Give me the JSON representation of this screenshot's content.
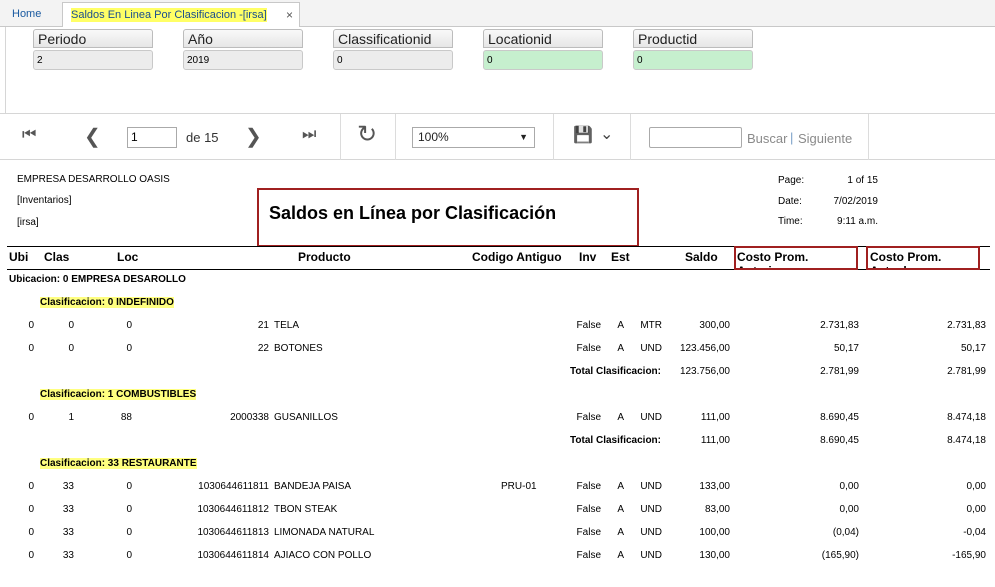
{
  "tabs": {
    "home": "Home",
    "active": "Saldos En Linea Por Clasificacion -[irsa]",
    "close": "×"
  },
  "params": [
    {
      "label": "Periodo",
      "value": "2",
      "green": false
    },
    {
      "label": "Año",
      "value": "2019",
      "green": false
    },
    {
      "label": "Classificationid",
      "value": "0",
      "green": false
    },
    {
      "label": "Locationid",
      "value": "0",
      "green": true
    },
    {
      "label": "Productid",
      "value": "0",
      "green": true
    }
  ],
  "toolbar": {
    "first_icon": "⏮",
    "prev_icon": "❮",
    "next_icon": "❯",
    "last_icon": "⏭",
    "page": "1",
    "of_pages": "de 15",
    "refresh_icon": "↻",
    "zoom": "100%",
    "zoom_arrow": "▼",
    "save_icon": "💾",
    "save_arrow": "⌄",
    "find_placeholder": "",
    "find_label": "Buscar",
    "pipe": "|",
    "next_label": "Siguiente"
  },
  "report": {
    "company": "EMPRESA DESARROLLO OASIS",
    "module": "[Inventarios]",
    "tenant": "[irsa]",
    "title": "Saldos en Línea por Clasificación",
    "page_label": "Page:",
    "page_value": "1 of 15",
    "date_label": "Date:",
    "date_value": "7/02/2019",
    "time_label": "Time:",
    "time_value": "9:11 a.m.",
    "headers": {
      "ubi": "Ubi",
      "clas": "Clas",
      "loc": "Loc",
      "producto": "Producto",
      "codigo": "Codigo Antiguo",
      "inv": "Inv",
      "est": "Est",
      "saldo": "Saldo",
      "costo_ant": "Costo Prom. Anterior",
      "costo_act": "Costo Prom. Actual"
    },
    "ubicacion": "Ubicacion:  0 EMPRESA DESAROLLO",
    "groups": [
      {
        "heading": "Clasificacion: 0 INDEFINIDO",
        "rows": [
          {
            "ubi": "0",
            "clas": "0",
            "loc": "0",
            "code": "21",
            "name": "TELA",
            "old": "",
            "inv": "False",
            "est": "A",
            "unit": "MTR",
            "saldo": "300,00",
            "ant": "2.731,83",
            "act": "2.731,83"
          },
          {
            "ubi": "0",
            "clas": "0",
            "loc": "0",
            "code": "22",
            "name": "BOTONES",
            "old": "",
            "inv": "False",
            "est": "A",
            "unit": "UND",
            "saldo": "123.456,00",
            "ant": "50,17",
            "act": "50,17"
          }
        ],
        "total": {
          "label": "Total Clasificacion:",
          "saldo": "123.756,00",
          "ant": "2.781,99",
          "act": "2.781,99"
        }
      },
      {
        "heading": "Clasificacion: 1 COMBUSTIBLES",
        "rows": [
          {
            "ubi": "0",
            "clas": "1",
            "loc": "88",
            "code": "2000338",
            "name": "GUSANILLOS",
            "old": "",
            "inv": "False",
            "est": "A",
            "unit": "UND",
            "saldo": "111,00",
            "ant": "8.690,45",
            "act": "8.474,18"
          }
        ],
        "total": {
          "label": "Total Clasificacion:",
          "saldo": "111,00",
          "ant": "8.690,45",
          "act": "8.474,18"
        }
      },
      {
        "heading": "Clasificacion: 33 RESTAURANTE",
        "rows": [
          {
            "ubi": "0",
            "clas": "33",
            "loc": "0",
            "code": "1030644611811",
            "name": "BANDEJA PAISA",
            "old": "PRU-01",
            "inv": "False",
            "est": "A",
            "unit": "UND",
            "saldo": "133,00",
            "ant": "0,00",
            "act": "0,00"
          },
          {
            "ubi": "0",
            "clas": "33",
            "loc": "0",
            "code": "1030644611812",
            "name": "TBON STEAK",
            "old": "",
            "inv": "False",
            "est": "A",
            "unit": "UND",
            "saldo": "83,00",
            "ant": "0,00",
            "act": "0,00"
          },
          {
            "ubi": "0",
            "clas": "33",
            "loc": "0",
            "code": "1030644611813",
            "name": "LIMONADA NATURAL",
            "old": "",
            "inv": "False",
            "est": "A",
            "unit": "UND",
            "saldo": "100,00",
            "ant": "(0,04)",
            "act": "-0,04"
          },
          {
            "ubi": "0",
            "clas": "33",
            "loc": "0",
            "code": "1030644611814",
            "name": "AJIACO CON POLLO",
            "old": "",
            "inv": "False",
            "est": "A",
            "unit": "UND",
            "saldo": "130,00",
            "ant": "(165,90)",
            "act": "-165,90"
          }
        ]
      }
    ]
  }
}
